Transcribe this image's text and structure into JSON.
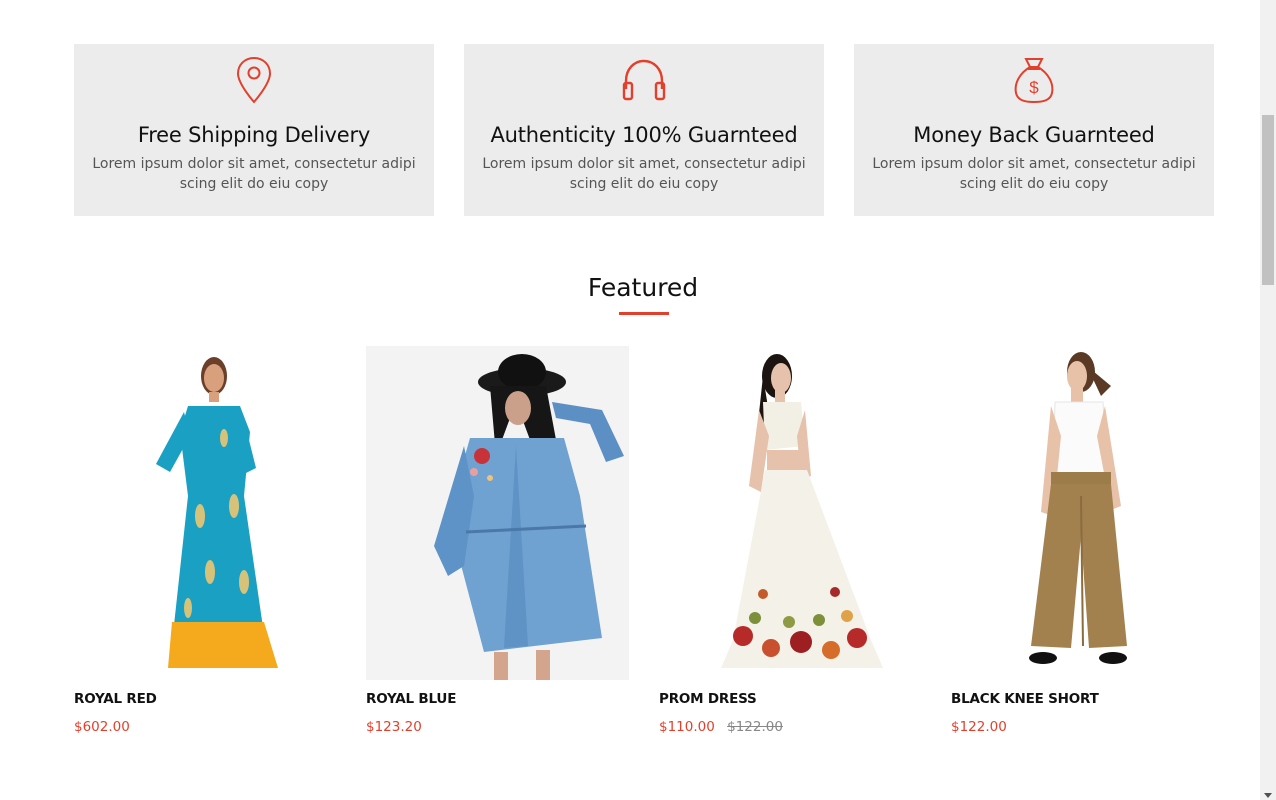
{
  "accent_color": "#e2402d",
  "features": [
    {
      "icon": "location-pin-icon",
      "title": "Free Shipping Delivery",
      "desc": "Lorem ipsum dolor sit amet, consectetur adipi scing elit do eiu copy"
    },
    {
      "icon": "headphones-icon",
      "title": "Authenticity 100% Guarnteed",
      "desc": "Lorem ipsum dolor sit amet, consectetur adipi scing elit do eiu copy"
    },
    {
      "icon": "money-bag-icon",
      "title": "Money Back Guarnteed",
      "desc": "Lorem ipsum dolor sit amet, consectetur adipi scing elit do eiu copy"
    }
  ],
  "section_title": "Featured",
  "products": [
    {
      "name": "ROYAL RED",
      "price": "$602.00",
      "old_price": ""
    },
    {
      "name": "ROYAL BLUE",
      "price": "$123.20",
      "old_price": ""
    },
    {
      "name": "PROM DRESS",
      "price": "$110.00",
      "old_price": "$122.00"
    },
    {
      "name": "BLACK KNEE SHORT",
      "price": "$122.00",
      "old_price": ""
    }
  ]
}
